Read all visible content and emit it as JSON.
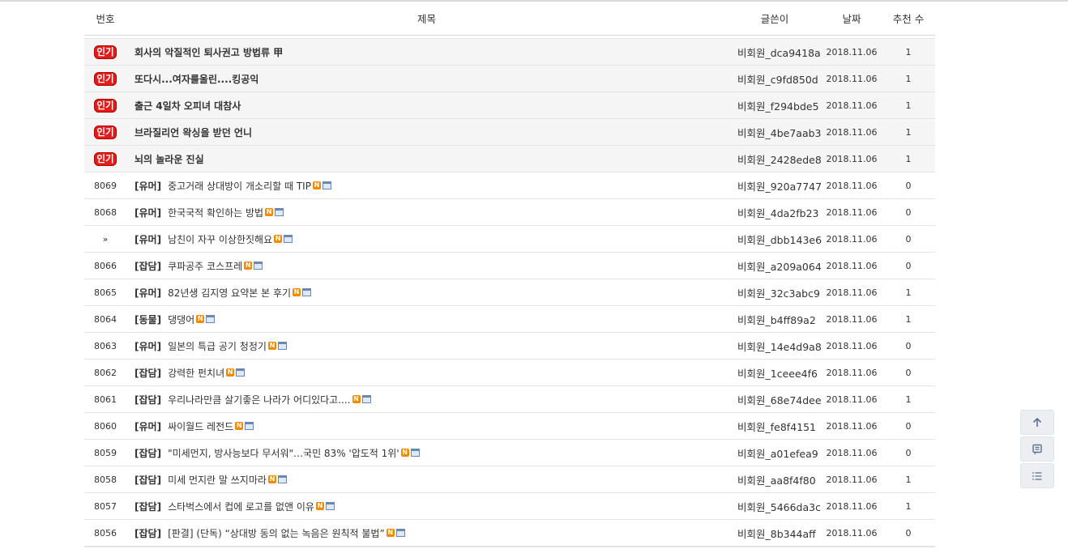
{
  "header": {
    "num": "번호",
    "title": "제목",
    "author": "글쓴이",
    "date": "날짜",
    "recommend": "추천 수"
  },
  "hot_posts": [
    {
      "badge": "인기",
      "title": "회사의 악질적인 퇴사권고 방법류 甲",
      "author": "비회원_dca9418a",
      "date": "2018.11.06",
      "recommend": "1"
    },
    {
      "badge": "인기",
      "title": "또다시...여자를울린....킹공익",
      "author": "비회원_c9fd850d",
      "date": "2018.11.06",
      "recommend": "1"
    },
    {
      "badge": "인기",
      "title": "출근 4일차 오피녀 대참사",
      "author": "비회원_f294bde5",
      "date": "2018.11.06",
      "recommend": "1"
    },
    {
      "badge": "인기",
      "title": "브라질리언 왁싱을 받던 언니",
      "author": "비회원_4be7aab3",
      "date": "2018.11.06",
      "recommend": "1"
    },
    {
      "badge": "인기",
      "title": "뇌의 놀라운 진실",
      "author": "비회원_2428ede8",
      "date": "2018.11.06",
      "recommend": "1"
    }
  ],
  "posts": [
    {
      "num": "8069",
      "category": "[유머]",
      "title": "중고거래 상대방이 개소리할 때 TIP",
      "author": "비회원_920a7747",
      "date": "2018.11.06",
      "recommend": "0"
    },
    {
      "num": "8068",
      "category": "[유머]",
      "title": "한국국적 확인하는 방법",
      "author": "비회원_4da2fb23",
      "date": "2018.11.06",
      "recommend": "0"
    },
    {
      "num": "»",
      "category": "[유머]",
      "title": "남친이 자꾸 이상한짓해요",
      "author": "비회원_dbb143e6",
      "date": "2018.11.06",
      "recommend": "0"
    },
    {
      "num": "8066",
      "category": "[잡담]",
      "title": "쿠파공주 코스프레",
      "author": "비회원_a209a064",
      "date": "2018.11.06",
      "recommend": "0"
    },
    {
      "num": "8065",
      "category": "[유머]",
      "title": "82년생 김지영 요약본 본 후기",
      "author": "비회원_32c3abc9",
      "date": "2018.11.06",
      "recommend": "1"
    },
    {
      "num": "8064",
      "category": "[동물]",
      "title": "댕댕어",
      "author": "비회원_b4ff89a2",
      "date": "2018.11.06",
      "recommend": "1"
    },
    {
      "num": "8063",
      "category": "[유머]",
      "title": "일본의 특급 공기 청정기",
      "author": "비회원_14e4d9a8",
      "date": "2018.11.06",
      "recommend": "0"
    },
    {
      "num": "8062",
      "category": "[잡담]",
      "title": "강력한 펀치녀",
      "author": "비회원_1ceee4f6",
      "date": "2018.11.06",
      "recommend": "0"
    },
    {
      "num": "8061",
      "category": "[잡담]",
      "title": "우리나라만큼 살기좋은 나라가 어디있다고....",
      "author": "비회원_68e74dee",
      "date": "2018.11.06",
      "recommend": "1"
    },
    {
      "num": "8060",
      "category": "[유머]",
      "title": "싸이월드 레전드",
      "author": "비회원_fe8f4151",
      "date": "2018.11.06",
      "recommend": "0"
    },
    {
      "num": "8059",
      "category": "[잡담]",
      "title": "\"미세먼지, 방사능보다 무서워\"…국민 83% '압도적 1위'",
      "author": "비회원_a01efea9",
      "date": "2018.11.06",
      "recommend": "0"
    },
    {
      "num": "8058",
      "category": "[잡담]",
      "title": "미세 먼지란 말 쓰지마라",
      "author": "비회원_aa8f4f80",
      "date": "2018.11.06",
      "recommend": "1"
    },
    {
      "num": "8057",
      "category": "[잡담]",
      "title": "스타벅스에서 컵에 로고를 없앤 이유",
      "author": "비회원_5466da3c",
      "date": "2018.11.06",
      "recommend": "1"
    },
    {
      "num": "8056",
      "category": "[잡담]",
      "title": "[판결] (단독) “상대방 동의 없는 녹음은 원칙적 불법”",
      "author": "비회원_8b344aff",
      "date": "2018.11.06",
      "recommend": "0"
    }
  ],
  "icons": {
    "new": "N",
    "side_top": "arrow-up-icon",
    "side_comment": "comment-icon",
    "side_list": "list-icon"
  }
}
